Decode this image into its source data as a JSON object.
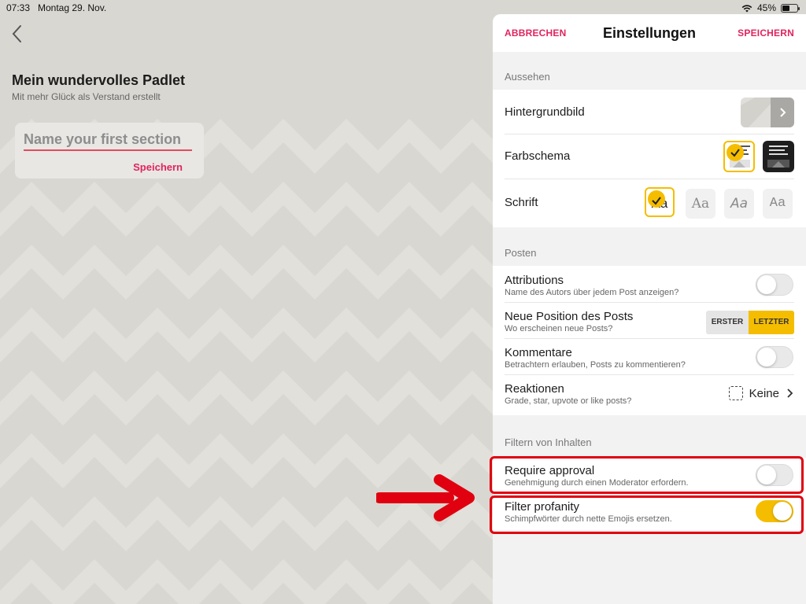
{
  "status_bar": {
    "time": "07:33",
    "date": "Montag 29. Nov.",
    "battery": "45%"
  },
  "padlet": {
    "title": "Mein wundervolles Padlet",
    "subtitle": "Mit mehr Glück als Verstand erstellt",
    "section_placeholder": "Name your first section",
    "section_save": "Speichern"
  },
  "settings": {
    "cancel": "ABBRECHEN",
    "title": "Einstellungen",
    "save": "SPEICHERN",
    "aussehen": {
      "header": "Aussehen",
      "background_label": "Hintergrundbild",
      "color_scheme_label": "Farbschema",
      "font_label": "Schrift",
      "font_options": [
        "Aa",
        "Aa",
        "Aa",
        "Aa"
      ]
    },
    "posten": {
      "header": "Posten",
      "attributions_label": "Attributions",
      "attributions_sub": "Name des Autors über jedem Post anzeigen?",
      "attributions_on": false,
      "position_label": "Neue Position des Posts",
      "position_sub": "Wo erscheinen neue Posts?",
      "position_first": "ERSTER",
      "position_last": "LETZTER",
      "comments_label": "Kommentare",
      "comments_sub": "Betrachtern erlauben, Posts zu kommentieren?",
      "comments_on": false,
      "reactions_label": "Reaktionen",
      "reactions_sub": "Grade, star, upvote or like posts?",
      "reactions_value": "Keine"
    },
    "filter": {
      "header": "Filtern von Inhalten",
      "approval_label": "Require approval",
      "approval_sub": "Genehmigung durch einen Moderator erfordern.",
      "approval_on": false,
      "profanity_label": "Filter profanity",
      "profanity_sub": "Schimpfwörter durch nette Emojis ersetzen.",
      "profanity_on": true
    }
  },
  "colors": {
    "accent_pink": "#e0245e",
    "accent_yellow": "#f5bd00",
    "highlight_red": "#e0000f"
  }
}
